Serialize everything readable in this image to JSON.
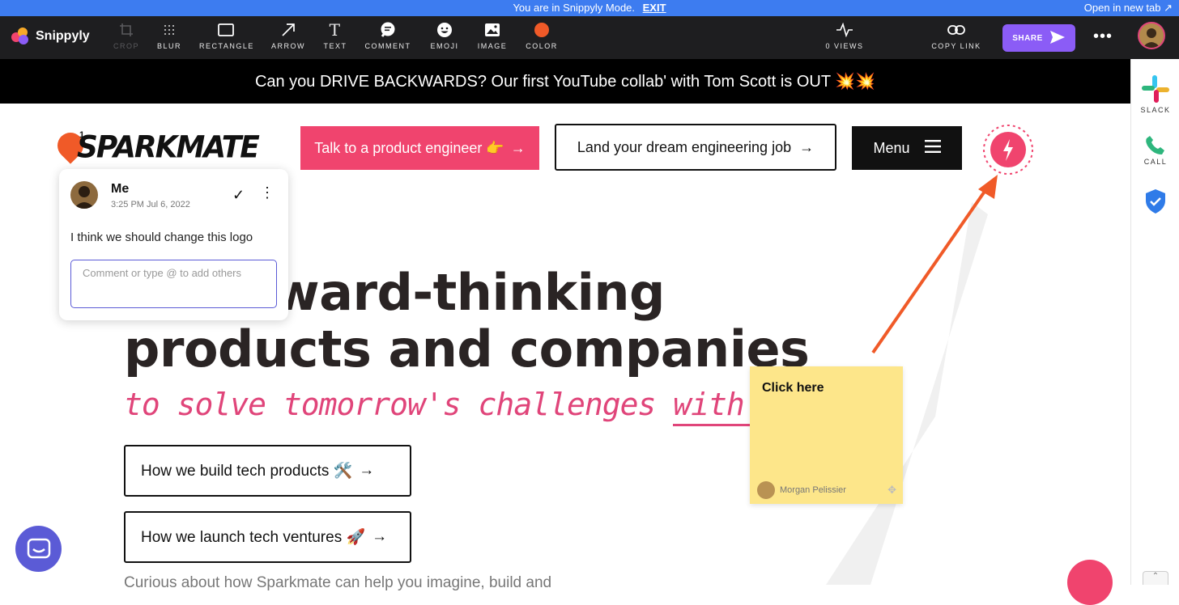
{
  "mode_bar": {
    "message": "You are in Snippyly Mode.",
    "exit_label": "EXIT",
    "open_new_tab": "Open in new tab"
  },
  "toolbar": {
    "brand": "Snippyly",
    "tools": [
      {
        "label": "CROP",
        "icon": "crop-icon",
        "disabled": true
      },
      {
        "label": "BLUR",
        "icon": "blur-icon"
      },
      {
        "label": "RECTANGLE",
        "icon": "rectangle-icon"
      },
      {
        "label": "ARROW",
        "icon": "arrow-icon"
      },
      {
        "label": "TEXT",
        "icon": "text-icon"
      },
      {
        "label": "COMMENT",
        "icon": "comment-icon"
      },
      {
        "label": "EMOJI",
        "icon": "emoji-icon"
      },
      {
        "label": "IMAGE",
        "icon": "image-icon"
      },
      {
        "label": "COLOR",
        "icon": "color-dot-icon",
        "color": "#f05a28"
      }
    ],
    "views": "0 VIEWS",
    "copy_link": "COPY LINK",
    "share": "SHARE"
  },
  "announcement": "Can you DRIVE BACKWARDS? Our first YouTube collab' with Tom Scott is OUT 💥💥",
  "sidebar": {
    "items": [
      {
        "label": "SLACK",
        "icon": "slack-icon"
      },
      {
        "label": "CALL",
        "icon": "phone-icon"
      },
      {
        "label": "",
        "icon": "shield-check-icon"
      }
    ]
  },
  "site": {
    "logo": "SPARKMATE",
    "pin_count": "1",
    "talk_button": "Talk to a product engineer 👉",
    "job_button": "Land your dream engineering job",
    "menu_button": "Menu",
    "headline_line1": "ld forward-thinking",
    "headline_line2": "products and companies",
    "tagline_start": "to solve tomorrow's challenges",
    "tagline_end": "with you",
    "cta_1": "How we build tech products 🛠️",
    "cta_2": "How we launch tech ventures 🚀",
    "subtext": "Curious about how Sparkmate can help you imagine, build and"
  },
  "comment": {
    "author": "Me",
    "time": "3:25 PM Jul 6, 2022",
    "text": "I think we should change this logo",
    "placeholder": "Comment or type @ to add others"
  },
  "sticky_note": {
    "title": "Click here",
    "author": "Morgan Pelissier"
  },
  "colors": {
    "accent_pink": "#f0446e",
    "snippyly_purple": "#8b5cf6",
    "annotation_orange": "#f05a28",
    "sticky_yellow": "#fde68a"
  }
}
